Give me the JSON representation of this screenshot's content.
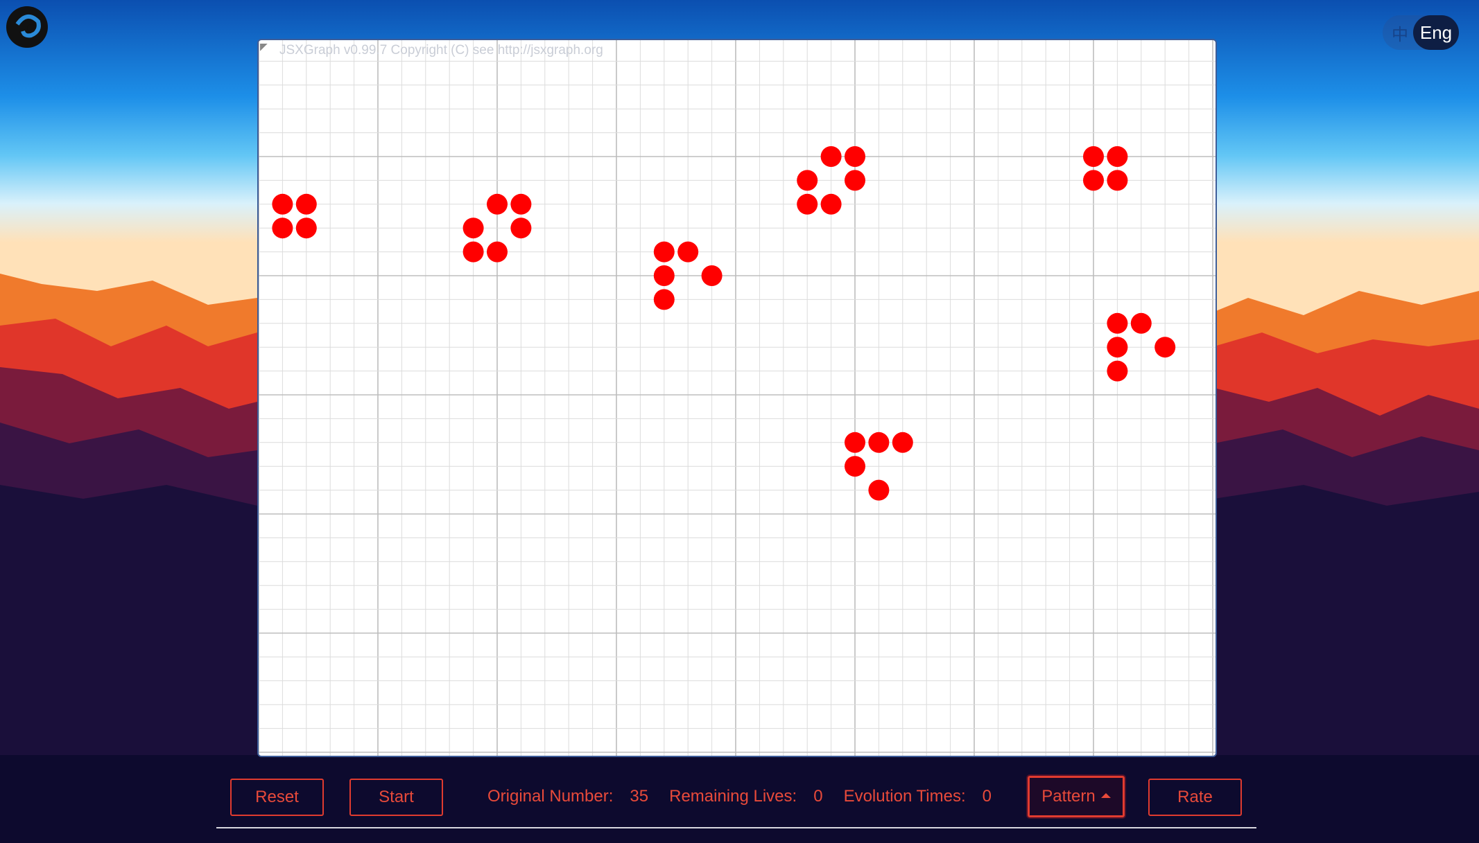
{
  "app": {
    "logo_icon": "swirl-logo-icon",
    "lang": {
      "cn_label": "中",
      "en_label": "Eng",
      "active": "Eng"
    }
  },
  "board": {
    "copyright": "JSXGraph v0.99.7 Copyright (C) see http://jsxgraph.org",
    "grid_columns": 40,
    "grid_rows": 30,
    "cell_color": "#ff0000",
    "live_cells": [
      [
        1,
        7
      ],
      [
        2,
        7
      ],
      [
        1,
        8
      ],
      [
        2,
        8
      ],
      [
        10,
        7
      ],
      [
        11,
        7
      ],
      [
        9,
        8
      ],
      [
        11,
        8
      ],
      [
        9,
        9
      ],
      [
        10,
        9
      ],
      [
        17,
        9
      ],
      [
        18,
        9
      ],
      [
        17,
        10
      ],
      [
        19,
        10
      ],
      [
        17,
        11
      ],
      [
        24,
        5
      ],
      [
        25,
        5
      ],
      [
        23,
        6
      ],
      [
        25,
        6
      ],
      [
        23,
        7
      ],
      [
        24,
        7
      ],
      [
        35,
        5
      ],
      [
        36,
        5
      ],
      [
        35,
        6
      ],
      [
        36,
        6
      ],
      [
        36,
        12
      ],
      [
        37,
        12
      ],
      [
        36,
        13
      ],
      [
        38,
        13
      ],
      [
        36,
        14
      ],
      [
        25,
        17
      ],
      [
        26,
        17
      ],
      [
        27,
        17
      ],
      [
        25,
        18
      ],
      [
        26,
        19
      ]
    ]
  },
  "controls": {
    "reset_label": "Reset",
    "start_label": "Start",
    "pattern_label": "Pattern",
    "rate_label": "Rate"
  },
  "stats": {
    "original_label": "Original Number:",
    "original_value": "35",
    "lives_label": "Remaining Lives:",
    "lives_value": "0",
    "evolution_label": "Evolution Times:",
    "evolution_value": "0"
  },
  "colors": {
    "accent": "#e84a3a",
    "board_border": "#3d5d99"
  }
}
